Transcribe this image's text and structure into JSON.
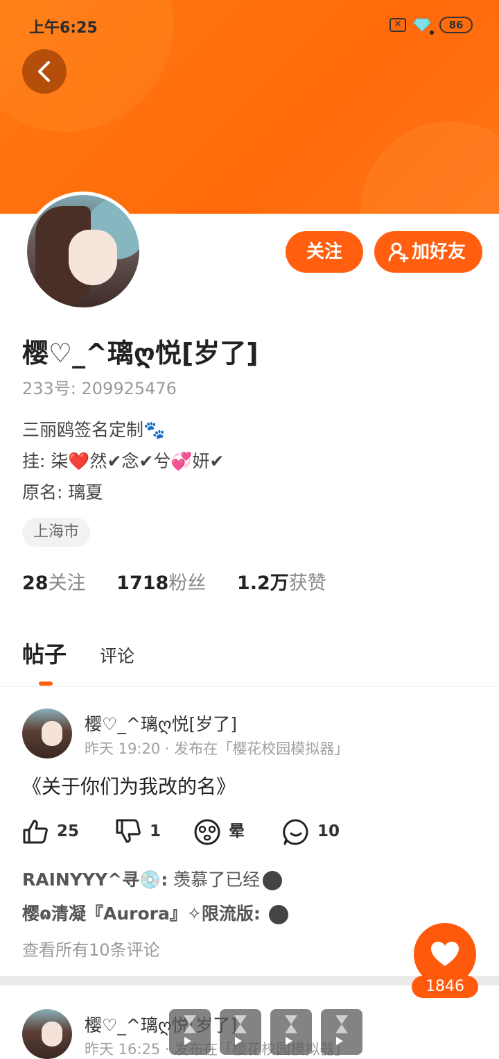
{
  "status_bar": {
    "time": "上午6:25",
    "battery": "86"
  },
  "profile": {
    "name": "樱♡_^璃ღ悦[岁了]",
    "uid": "233号: 209925476",
    "bio_lines": [
      "三丽鸥签名定制🐾",
      "挂: 柒❤️然✔念✔兮💞妍✔",
      "原名: 璃夏"
    ],
    "location": "上海市",
    "follow_button": "关注",
    "add_friend_button": "加好友"
  },
  "stats": [
    {
      "value": "28",
      "label": "关注"
    },
    {
      "value": "1718",
      "label": "粉丝"
    },
    {
      "value": "1.2万",
      "label": "获赞"
    }
  ],
  "tabs": {
    "posts": "帖子",
    "comments": "评论"
  },
  "posts": [
    {
      "author": "樱♡_^璃ღ悦[岁了]",
      "meta": "昨天 19:20 · 发布在「樱花校园模拟器」",
      "title": "《关于你们为我改的名》",
      "likes": "25",
      "dislikes": "1",
      "reaction": "晕",
      "comments": "10",
      "comment_previews": [
        {
          "user": "RAINYYY^寻💿:",
          "text": " 羡慕了已经"
        },
        {
          "user": "樱ɷ清凝『Aurora』✧限流版:",
          "text": " "
        }
      ],
      "view_all": "查看所有10条评论"
    },
    {
      "author": "樱♡_^璃ღ悦[岁了]",
      "meta": "昨天 16:25 · 发布在「樱花校园模拟器」"
    }
  ],
  "fab": {
    "count": "1846"
  },
  "colors": {
    "accent": "#ff5f0e"
  }
}
